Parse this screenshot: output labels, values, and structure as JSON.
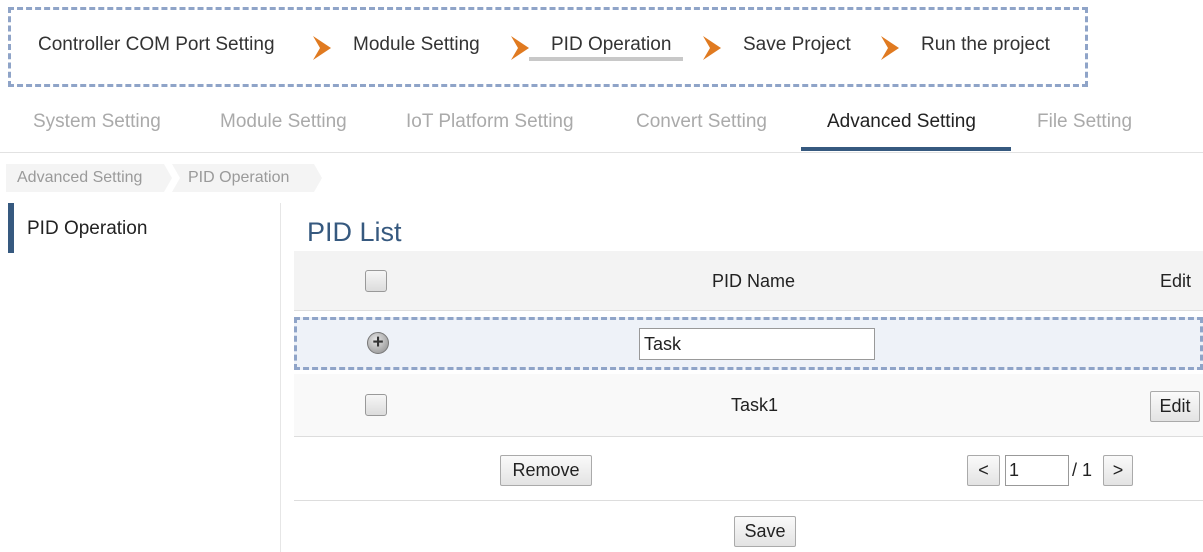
{
  "wizard": {
    "steps": [
      "Controller COM Port Setting",
      "Module Setting",
      "PID Operation",
      "Save Project",
      "Run the project"
    ],
    "active_step": "PID Operation",
    "arrow_color": "#e07a20"
  },
  "tabs": {
    "items": [
      "System Setting",
      "Module Setting",
      "IoT Platform Setting",
      "Convert Setting",
      "Advanced Setting",
      "File Setting"
    ],
    "active": "Advanced Setting"
  },
  "breadcrumb": [
    "Advanced Setting",
    "PID Operation"
  ],
  "sidebar": {
    "items": [
      "PID Operation"
    ],
    "active": "PID Operation"
  },
  "main": {
    "title": "PID List",
    "table": {
      "headers": {
        "name": "PID Name",
        "edit": "Edit"
      },
      "new_row": {
        "name_value": "Task"
      },
      "rows": [
        {
          "name": "Task1",
          "edit_label": "Edit"
        }
      ]
    },
    "remove_label": "Remove",
    "pagination": {
      "prev": "<",
      "current": "1",
      "total": "/ 1",
      "next": ">"
    },
    "save_label": "Save"
  },
  "colors": {
    "accent": "#36597f",
    "dashed_border": "#8fa4c8"
  }
}
